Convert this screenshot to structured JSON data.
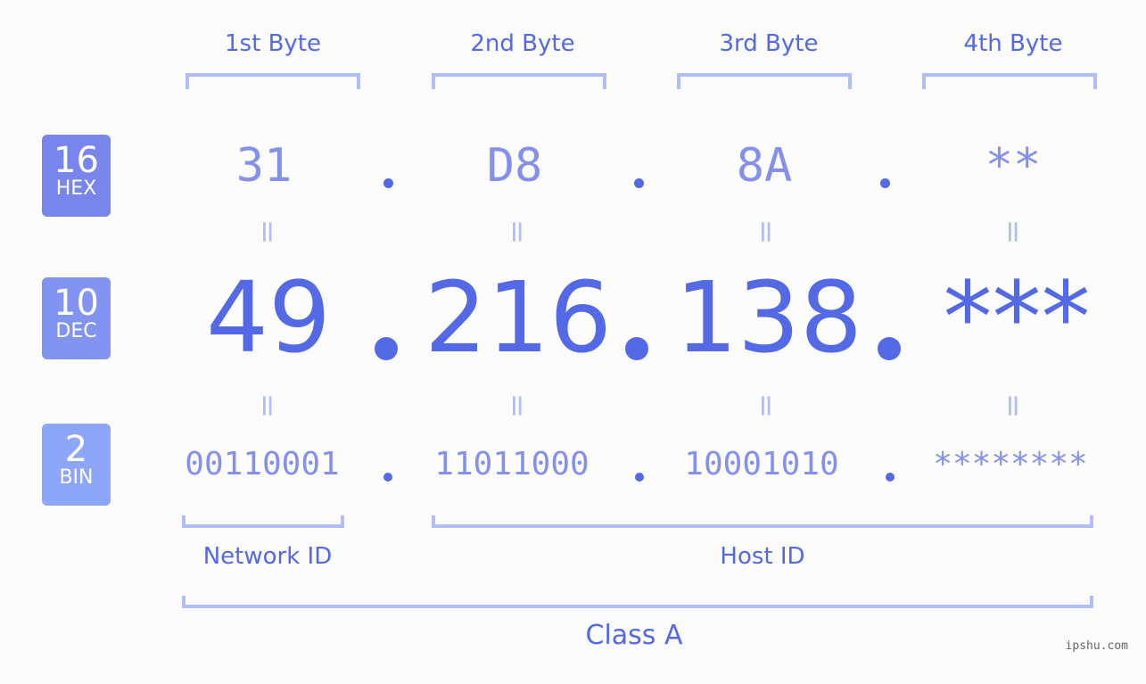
{
  "byte_headers": [
    "1st Byte",
    "2nd Byte",
    "3rd Byte",
    "4th Byte"
  ],
  "rows": {
    "hex": {
      "base": "16",
      "label": "HEX",
      "values": [
        "31",
        "D8",
        "8A",
        "**"
      ],
      "color": "#7885ec"
    },
    "dec": {
      "base": "10",
      "label": "DEC",
      "values": [
        "49",
        "216",
        "138",
        "***"
      ],
      "color": "#8294f1"
    },
    "bin": {
      "base": "2",
      "label": "BIN",
      "values": [
        "00110001",
        "11011000",
        "10001010",
        "********"
      ],
      "color": "#8ea6f8"
    }
  },
  "equals_symbol": "=",
  "segments": {
    "network": "Network ID",
    "host": "Host ID",
    "class": "Class A"
  },
  "watermark": "ipshu.com",
  "colors": {
    "accent": "#5469e6",
    "light": "#b3bdf7",
    "mid": "#8490ec"
  }
}
